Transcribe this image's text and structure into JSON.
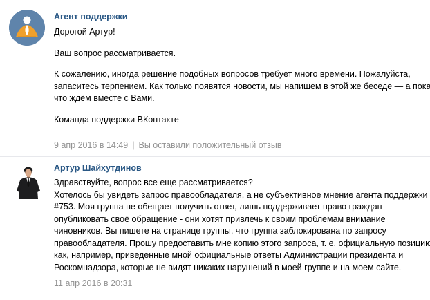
{
  "messages": [
    {
      "author": "Агент поддержки",
      "avatar_icon": "support-agent-avatar",
      "paragraphs": [
        [
          "Дорогой Артур!"
        ],
        [
          "Ваш вопрос рассматривается."
        ],
        [
          "К сожалению, иногда решение подобных вопросов требует много времени. Пожалуйста,",
          "запаситесь терпением. Как только появятся новости, мы напишем в этой же беседе — а пока",
          "что ждём вместе с Вами."
        ],
        [
          "Команда поддержки ВКонтакте"
        ]
      ],
      "date": "9 апр 2016 в 14:49",
      "rating_note": "Вы оставили положительный отзыв"
    },
    {
      "author": "Артур Шайхутдинов",
      "avatar_icon": "user-photo-avatar",
      "lines": [
        "Здравствуйте, вопрос все еще рассматривается?",
        "Хотелось бы увидеть запрос правообладателя, а не субъективное мнение агента поддержки",
        "#753. Моя группа не обещает получить ответ, лишь поддерживает право граждан",
        "опубликовать своё обращение - они хотят привлечь к своим проблемам внимание",
        "чиновников. Вы пишете на странице группы, что группа заблокирована по запросу",
        "правообладателя. Прошу предоставить мне копию этого запроса, т. е. официальную позицию,",
        "как, например, приведенные мной официальные ответы Администрации президента и",
        "Роскомнадзора, которые не видят никаких нарушений в моей группе и на моем сайте."
      ],
      "date": "11 апр 2016 в 20:31"
    }
  ],
  "colors": {
    "link": "#2a5885",
    "meta": "#939393",
    "divider": "#e7e8ec",
    "support_avatar_bg": "#5f84ab",
    "support_avatar_figure": "#f0a02c"
  }
}
